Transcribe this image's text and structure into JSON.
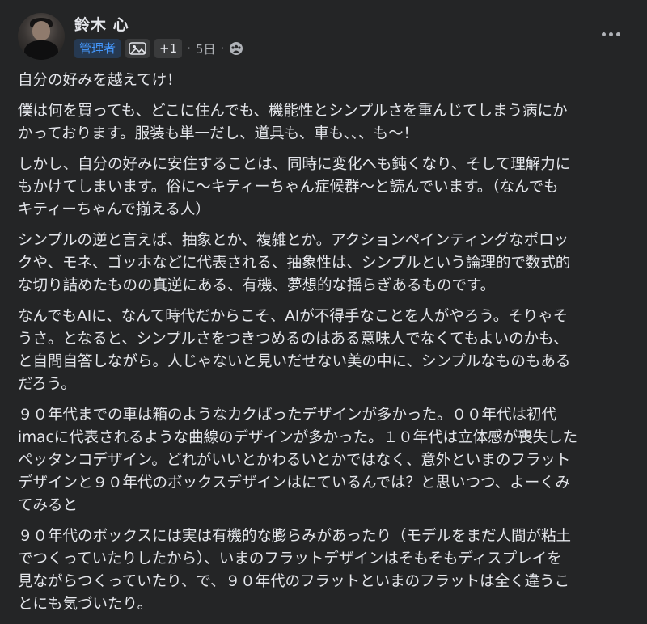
{
  "author": {
    "name": "鈴木 心",
    "role_badge": "管理者",
    "extra_badges": "+1",
    "timestamp": "5日",
    "separator": "·",
    "audience_icon": "group-icon",
    "badge_icon": "top-contributor-icon"
  },
  "post": {
    "paragraphs": [
      "自分の好みを越えてけ！",
      "僕は何を買っても、どこに住んでも、機能性とシンプルさを重んじてしまう病にか\nかっております。服装も単一だし、道具も、車も、、、も〜！",
      "しかし、自分の好みに安住することは、同時に変化へも鈍くなり、そして理解力に\nもかけてしまいます。俗に〜キティーちゃん症候群〜と読んでいます。（なんでも\nキティーちゃんで揃える人）",
      "シンプルの逆と言えば、抽象とか、複雑とか。アクションペインティングなポロッ\nクや、モネ、ゴッホなどに代表される、抽象性は、シンプルという論理的で数式的\nな切り詰めたものの真逆にある、有機、夢想的な揺らぎあるものです。",
      "なんでもAIに、なんて時代だからこそ、AIが不得手なことを人がやろう。そりゃそ\nうさ。となると、シンプルさをつきつめるのはある意味人でなくてもよいのかも、\nと自問自答しながら。人じゃないと見いだせない美の中に、シンプルなものもある\nだろう。",
      "９０年代までの車は箱のようなカクばったデザインが多かった。００年代は初代\nimacに代表されるような曲線のデザインが多かった。１０年代は立体感が喪失した\nペッタンコデザイン。どれがいいとかわるいとかではなく、意外といまのフラット\nデザインと９０年代のボックスデザインはにているんでは？と思いつつ、よーくみ\nてみると",
      "９０年代のボックスには実は有機的な膨らみがあったり（モデルをまだ人間が粘土\nでつくっていたりしたから）、いまのフラットデザインはそもそもディスプレイを\n見ながらつくっていたり、で、９０年代のフラットといまのフラットは全く違うこ\nとにも気づいたり。"
    ]
  },
  "colors": {
    "background": "#242526",
    "text": "#e4e6eb",
    "secondary_text": "#b0b3b8",
    "admin_badge_bg": "#263951",
    "admin_badge_text": "#4599ff"
  }
}
